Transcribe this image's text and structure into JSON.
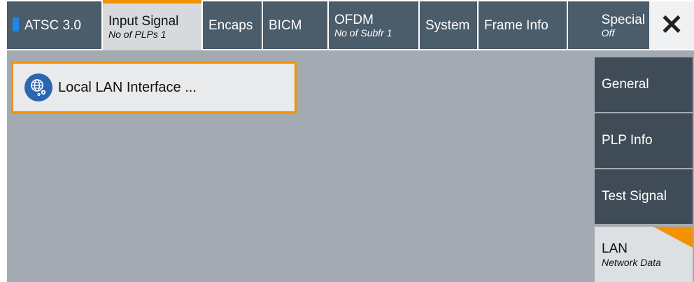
{
  "tabs": [
    {
      "label": "ATSC 3.0",
      "sub": ""
    },
    {
      "label": "Input Signal",
      "sub": "No of PLPs 1"
    },
    {
      "label": "Encaps",
      "sub": ""
    },
    {
      "label": "BICM",
      "sub": ""
    },
    {
      "label": "OFDM",
      "sub": "No of Subfr 1"
    },
    {
      "label": "System",
      "sub": ""
    },
    {
      "label": "Frame Info",
      "sub": ""
    },
    {
      "label": "Special",
      "sub": "Off"
    }
  ],
  "close": {
    "icon": "close-icon",
    "glyph": "✕"
  },
  "main": {
    "lan_button": {
      "label": "Local LAN Interface ...",
      "icon": "globe-gear-icon"
    }
  },
  "side_menu": [
    {
      "label": "General",
      "sub": ""
    },
    {
      "label": "PLP Info",
      "sub": ""
    },
    {
      "label": "Test Signal",
      "sub": ""
    },
    {
      "label": "LAN",
      "sub": "Network Data"
    }
  ],
  "colors": {
    "accent": "#f39200",
    "tab_bg": "#4b5c6a",
    "side_bg": "#3f4c57",
    "content_bg": "#a4aab1",
    "indicator": "#1e88e5"
  }
}
